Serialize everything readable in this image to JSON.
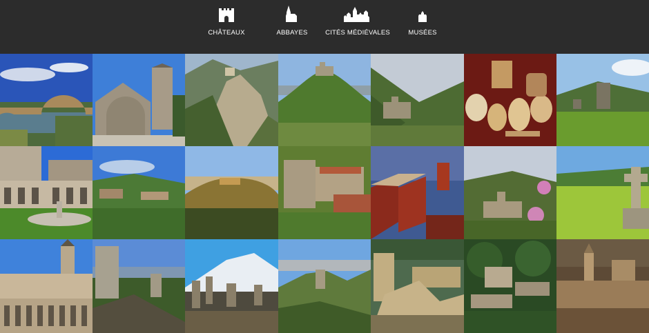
{
  "nav": [
    {
      "label": "CHÂTEAUX",
      "icon": "castle-icon"
    },
    {
      "label": "ABBAYES",
      "icon": "abbey-icon"
    },
    {
      "label": "CITÉS MÉDIÉVALES",
      "icon": "medieval-city-icon"
    },
    {
      "label": "MUSÉES",
      "icon": "museum-icon"
    }
  ],
  "colors": {
    "header_bg": "#2c2c2c",
    "nav_text": "#ffffff"
  }
}
